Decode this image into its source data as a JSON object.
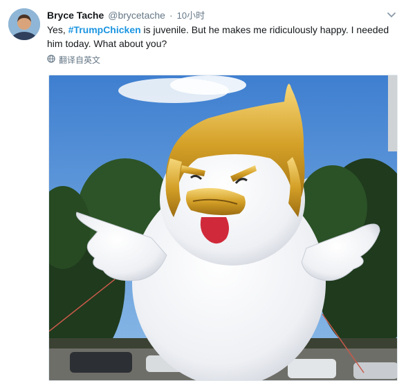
{
  "tweet": {
    "display_name": "Bryce Tache",
    "handle": "@brycetache",
    "separator": "·",
    "time": "10小时",
    "text_before": "Yes, ",
    "hashtag": "#TrumpChicken",
    "text_after": " is juvenile.  But he makes me ridiculously happy. I needed him today. What about you?",
    "translate_label": "翻译自英文"
  },
  "icons": {
    "more": "chevron-down-icon",
    "translate": "globe-icon"
  },
  "colors": {
    "link": "#1b95e0",
    "secondary_text": "#657786"
  }
}
